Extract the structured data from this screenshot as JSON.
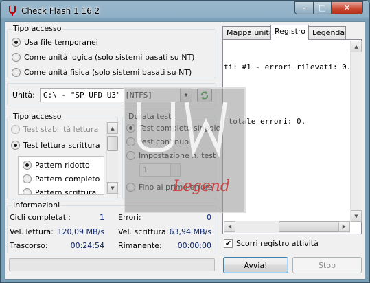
{
  "window": {
    "title": "Check Flash 1.16.2",
    "controls": {
      "minimize": "–",
      "maximize": "□",
      "close": "✕"
    }
  },
  "access_group": {
    "legend": "Tipo accesso",
    "options": [
      {
        "label": "Usa file temporanei",
        "selected": true
      },
      {
        "label": "Come unità logica (solo sistemi basati su NT)",
        "selected": false
      },
      {
        "label": "Come unità fisica (solo sistemi basati su NT)",
        "selected": false
      }
    ]
  },
  "drive": {
    "label": "Unità:",
    "value": "G:\\ - \"SP UFD U3\" [NTFS]"
  },
  "test_type": {
    "legend": "Tipo accesso",
    "options": [
      {
        "label": "Test stabilità lettura",
        "selected": false,
        "disabled": true
      },
      {
        "label": "Test lettura scrittura",
        "selected": true,
        "disabled": false
      }
    ],
    "patterns": [
      {
        "label": "Pattern ridotto",
        "selected": true
      },
      {
        "label": "Pattern completo",
        "selected": false
      },
      {
        "label": "Pattern scrittura",
        "selected": false
      }
    ]
  },
  "duration": {
    "legend": "Durata test",
    "options": [
      {
        "label": "Test completo singolo",
        "selected": true
      },
      {
        "label": "Test continuo",
        "selected": false
      },
      {
        "label": "Impostazione n. test",
        "selected": false
      },
      {
        "label": "Fino al primo errore",
        "selected": false
      }
    ],
    "count_value": "1"
  },
  "info": {
    "legend": "Informazioni",
    "cycles_label": "Cicli completati:",
    "cycles_value": "1",
    "errors_label": "Errori:",
    "errors_value": "0",
    "read_speed_label": "Vel. lettura:",
    "read_speed_value": "120,09 MB/s",
    "write_speed_label": "Vel. scrittura:",
    "write_speed_value": "63,94 MB/s",
    "elapsed_label": "Trascorso:",
    "elapsed_value": "00:24:54",
    "remaining_label": "Rimanente:",
    "remaining_value": "00:00:00"
  },
  "tabs": [
    {
      "label": "Mappa unità",
      "active": false
    },
    {
      "label": "Registro",
      "active": true
    },
    {
      "label": "Legenda",
      "active": false
    }
  ],
  "log": {
    "lines": [
      "ti: #1 - errori rilevati: 0.",
      "",
      " totale errori: 0."
    ]
  },
  "scroll_log": {
    "label": "Scorri registro attività",
    "checked": true
  },
  "buttons": {
    "start": "Avvia!",
    "stop": "Stop"
  },
  "watermark_text": "Legend"
}
